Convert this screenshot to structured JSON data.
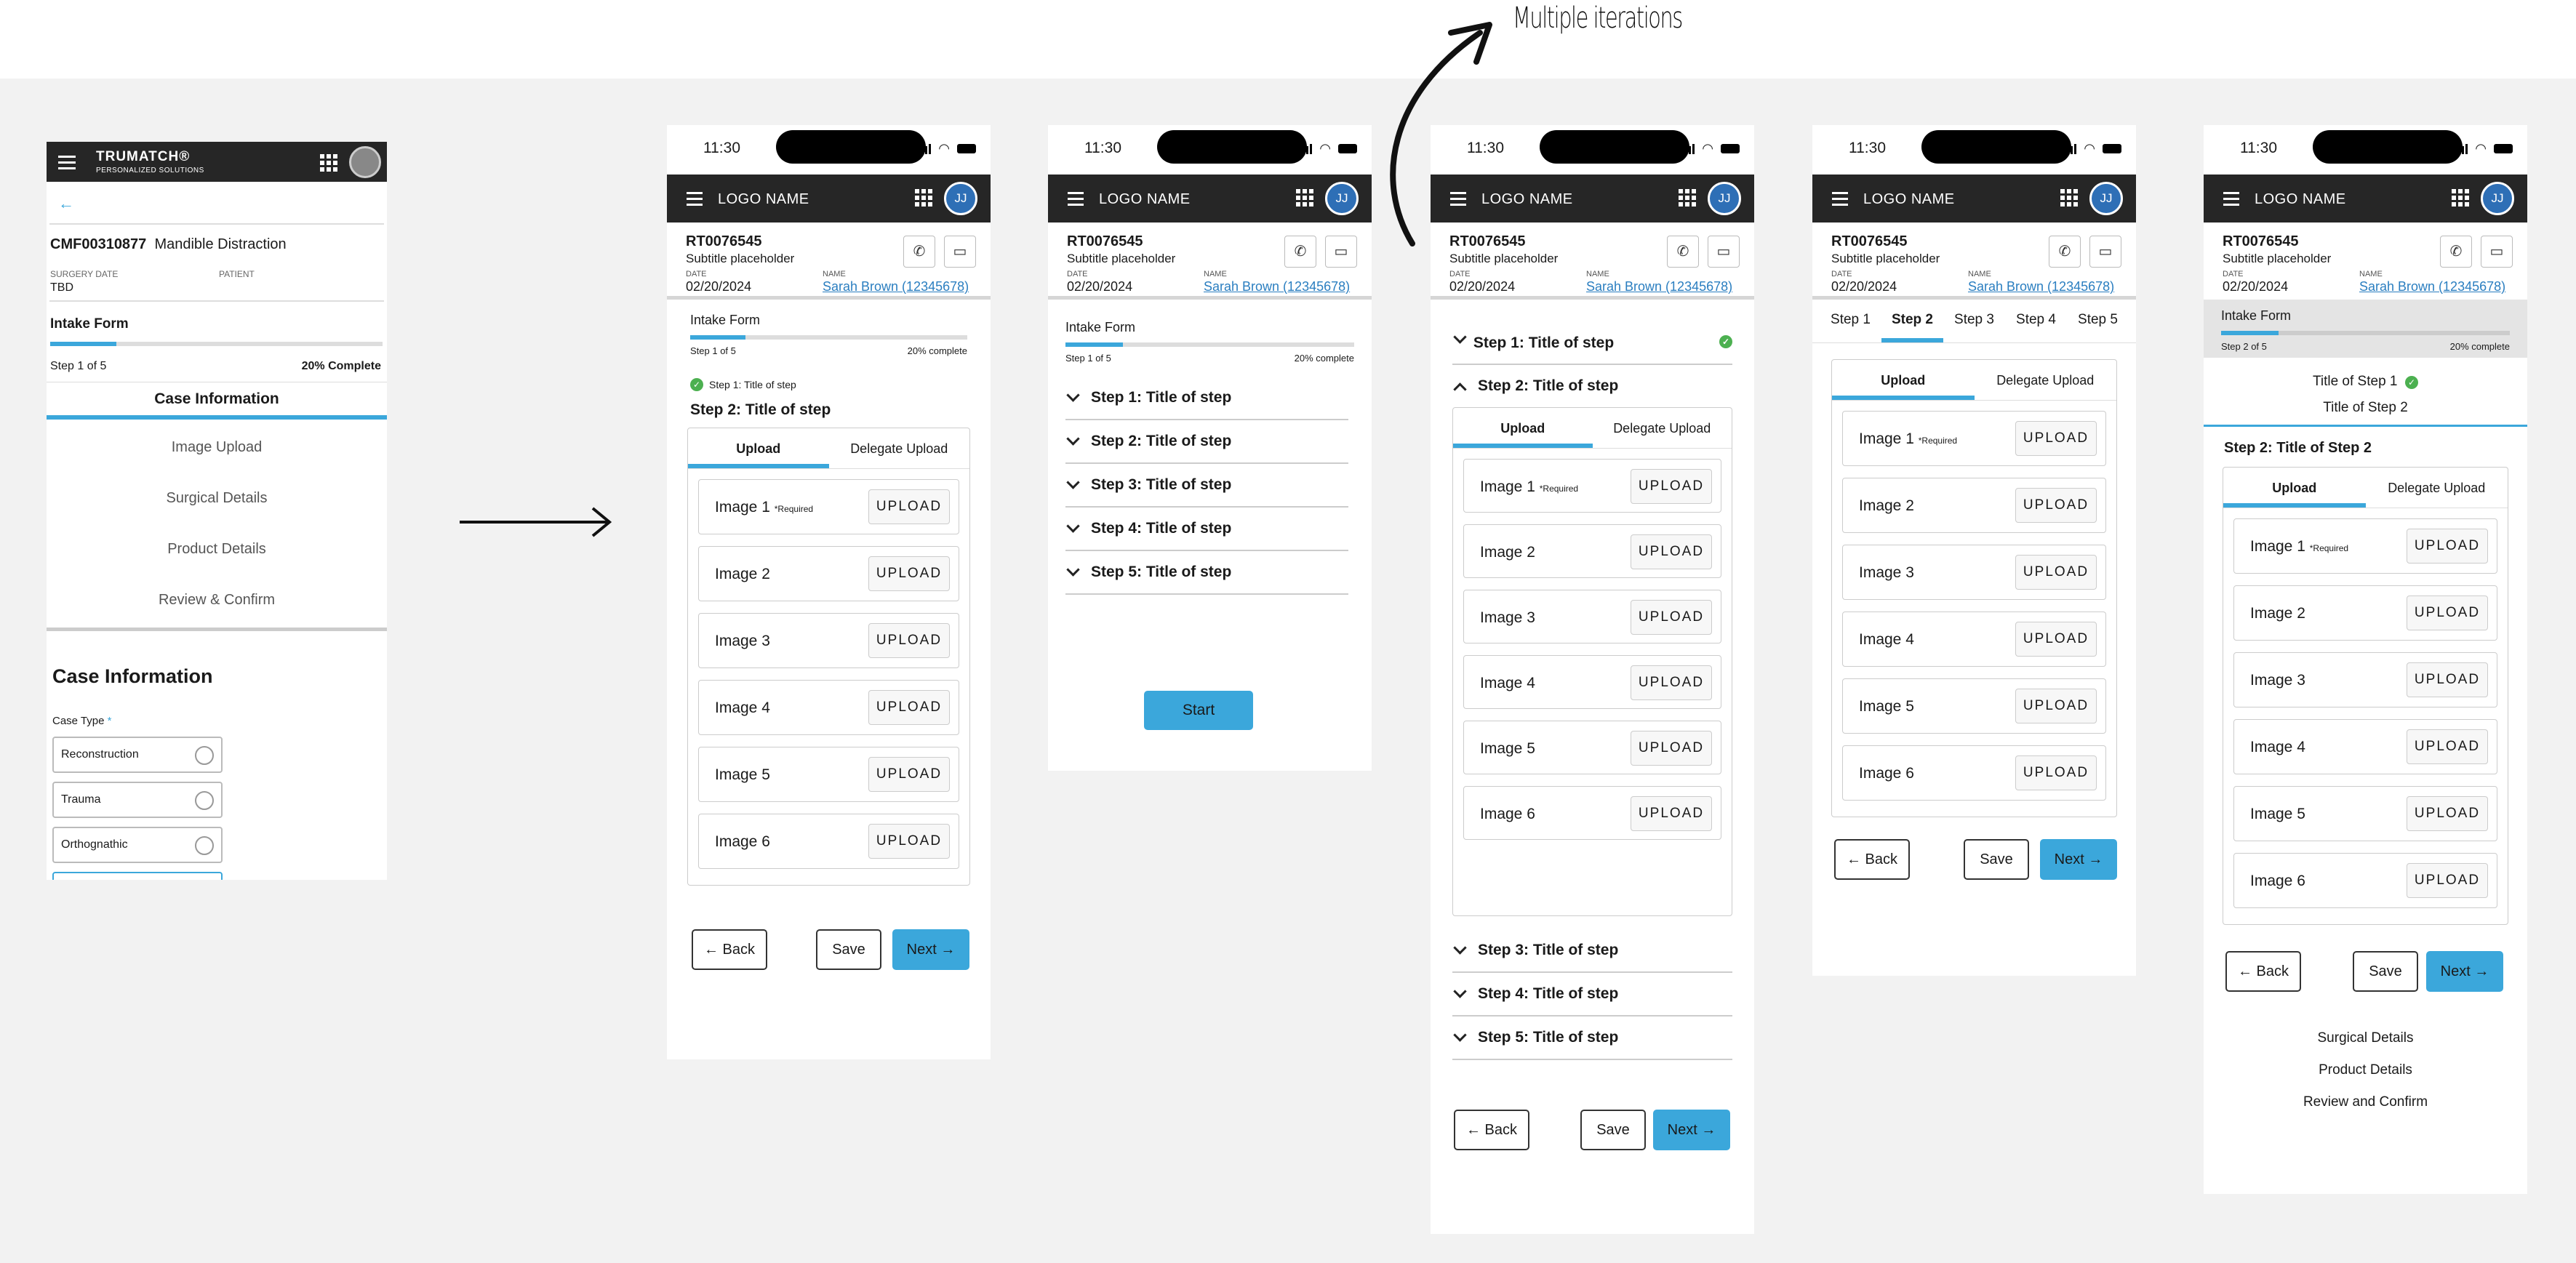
{
  "annotation": {
    "text": "Multiple iterations"
  },
  "desktop": {
    "brand": "TRUMATCH®",
    "brand_sub": "PERSONALIZED SOLUTIONS",
    "case_id": "CMF00310877",
    "case_name": "Mandible Distraction",
    "surgery_date_label": "SURGERY DATE",
    "surgery_date": "TBD",
    "patient_label": "PATIENT",
    "form_title": "Intake Form",
    "step_label": "Step 1 of 5",
    "complete_label": "20% Complete",
    "progress_fraction": 0.2,
    "nav_active": "Case Information",
    "nav_items": [
      "Image Upload",
      "Surgical Details",
      "Product Details",
      "Review & Confirm"
    ],
    "section_title": "Case Information",
    "case_type_label": "Case Type",
    "required_mark": "*",
    "options": [
      "Reconstruction",
      "Trauma",
      "Orthognathic"
    ]
  },
  "common": {
    "time": "11:30",
    "logo": "LOGO NAME",
    "avatar": "JJ",
    "rt": "RT0076545",
    "subtitle": "Subtitle placeholder",
    "date_label": "DATE",
    "date": "02/20/2024",
    "name_label": "NAME",
    "name": "Sarah Brown (12345678)",
    "upload_tab": "Upload",
    "delegate_tab": "Delegate Upload",
    "upload_btn": "UPLOAD",
    "required": "*Required",
    "images": [
      "Image 1",
      "Image 2",
      "Image 3",
      "Image 4",
      "Image 5",
      "Image 6"
    ],
    "back": "Back",
    "save": "Save",
    "next": "Next",
    "intake": "Intake Form",
    "step1of5": "Step 1 of 5",
    "step2of5": "Step 2 of 5",
    "pct": "20% complete",
    "progress_fraction": 0.2
  },
  "p1": {
    "done_step": "Step 1: Title of step",
    "step_title": "Step 2: Title of step"
  },
  "p2": {
    "steps": [
      "Step 1: Title of step",
      "Step 2: Title of step",
      "Step 3: Title of step",
      "Step 4: Title of step",
      "Step 5: Title of step"
    ],
    "start": "Start"
  },
  "p3": {
    "steps": [
      "Step 1: Title of step",
      "Step 2: Title of step",
      "Step 3: Title of step",
      "Step 4: Title of step",
      "Step 5: Title of step"
    ]
  },
  "p4": {
    "tabs": [
      "Step 1",
      "Step 2",
      "Step 3",
      "Step 4",
      "Step 5"
    ],
    "active_tab": "Step 2"
  },
  "p5": {
    "done_step": "Title of Step 1",
    "current_step": "Title of Step 2",
    "step_title": "Step 2: Title of Step 2",
    "links": [
      "Surgical Details",
      "Product Details",
      "Review and Confirm"
    ]
  },
  "colors": {
    "accent": "#3ba7db",
    "header": "#262626",
    "success": "#4cb050",
    "link": "#2a7ec0",
    "avatar": "#2e6fb6"
  }
}
